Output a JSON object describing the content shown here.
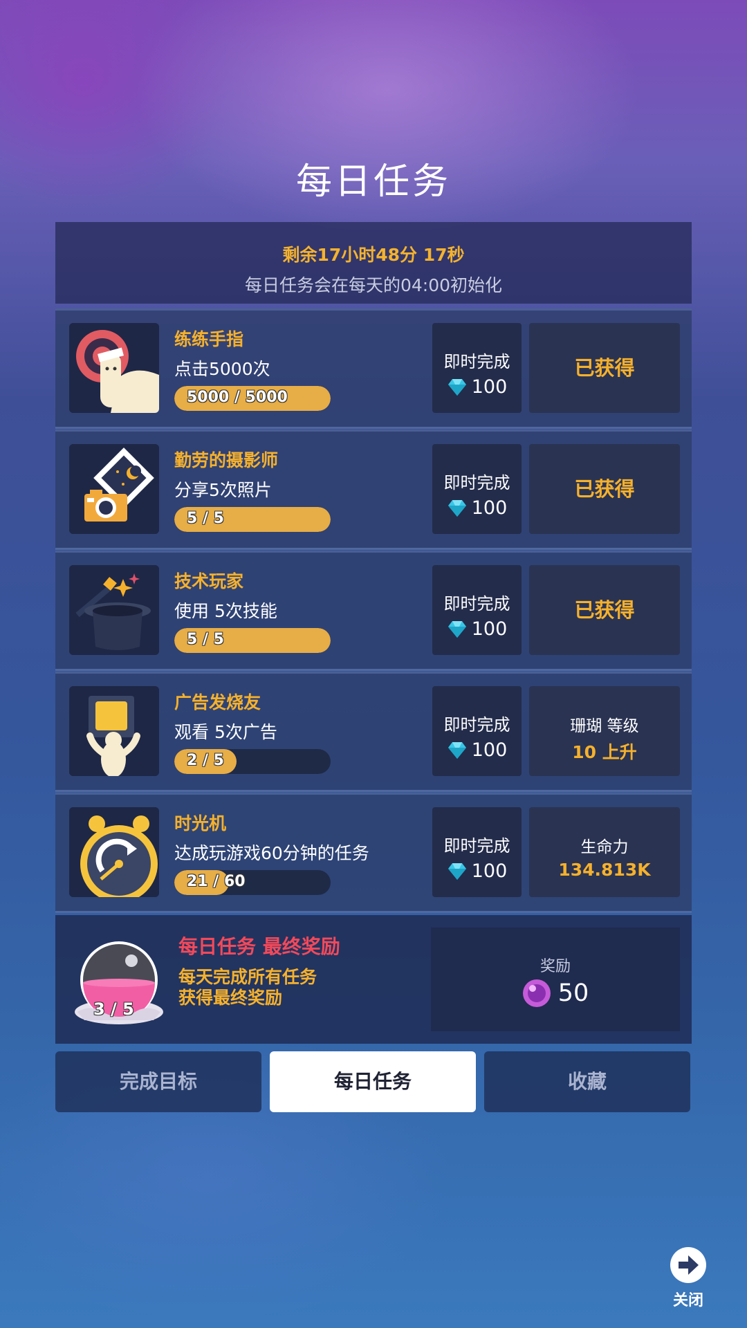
{
  "page": {
    "title": "每日任务"
  },
  "header": {
    "countdown": "剩余17小时48分 17秒",
    "reset_note": "每日任务会在每天的04:00初始化"
  },
  "colors": {
    "accent": "#f6b12c",
    "progress": "#e7ad46",
    "final_title": "#f3495a",
    "gem": "#39c6e6"
  },
  "tasks": [
    {
      "name": "练练手指",
      "desc": "点击5000次",
      "progress_text": "5000 / 5000",
      "progress": 1.0,
      "instant_label": "即时完成",
      "instant_value": "100",
      "status": "已获得",
      "icon": "finger-target-icon"
    },
    {
      "name": "勤劳的摄影师",
      "desc": "分享5次照片",
      "progress_text": "5 / 5",
      "progress": 1.0,
      "instant_label": "即时完成",
      "instant_value": "100",
      "status": "已获得",
      "icon": "camera-photo-icon"
    },
    {
      "name": "技术玩家",
      "desc": "使用 5次技能",
      "progress_text": "5 / 5",
      "progress": 1.0,
      "instant_label": "即时完成",
      "instant_value": "100",
      "status": "已获得",
      "icon": "magic-hat-icon"
    },
    {
      "name": "广告发烧友",
      "desc": "观看 5次广告",
      "progress_text": "2 / 5",
      "progress": 0.4,
      "instant_label": "即时完成",
      "instant_value": "100",
      "status_line1": "珊瑚 等级",
      "status_line2": "10 上升",
      "icon": "tv-ad-icon"
    },
    {
      "name": "时光机",
      "desc": "达成玩游戏60分钟的任务",
      "progress_text": "21 / 60",
      "progress": 0.35,
      "instant_label": "即时完成",
      "instant_value": "100",
      "status_line1": "生命力",
      "status_line2": "134.813K",
      "icon": "alarm-clock-icon"
    }
  ],
  "final_reward": {
    "title": "每日任务 最终奖励",
    "desc_line1": "每天完成所有任务",
    "desc_line2": "获得最终奖励",
    "progress_text": "3 / 5",
    "progress": 0.6,
    "reward_label": "奖励",
    "reward_value": "50",
    "icon": "pearl-orb-icon"
  },
  "tabs": [
    {
      "label": "完成目标",
      "active": false
    },
    {
      "label": "每日任务",
      "active": true
    },
    {
      "label": "收藏",
      "active": false
    }
  ],
  "close": {
    "label": "关闭"
  }
}
